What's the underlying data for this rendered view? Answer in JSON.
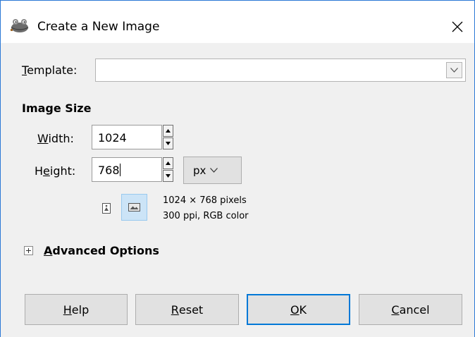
{
  "window": {
    "title": "Create a New Image",
    "icon": "gimp-wilber-icon",
    "close_icon": "close-icon"
  },
  "template": {
    "label_mnemonic": "T",
    "label_rest": "emplate:",
    "value": ""
  },
  "image_size": {
    "section_title": "Image Size",
    "width": {
      "label_mnemonic": "W",
      "label_rest": "idth:",
      "value": "1024"
    },
    "height": {
      "label_before": "H",
      "label_mnemonic": "e",
      "label_after": "ight:",
      "value": "768"
    },
    "unit": "px",
    "info_line1": "1024 × 768 pixels",
    "info_line2": "300 ppi, RGB color",
    "orientation_selected": "landscape"
  },
  "advanced": {
    "expander_symbol": "⊞",
    "label_mnemonic": "A",
    "label_rest": "dvanced Options"
  },
  "buttons": {
    "help": {
      "mnemonic": "H",
      "rest": "elp"
    },
    "reset": {
      "mnemonic": "R",
      "rest": "eset"
    },
    "ok": {
      "mnemonic": "O",
      "rest": "K"
    },
    "cancel": {
      "mnemonic": "C",
      "rest": "ancel"
    }
  },
  "colors": {
    "window_border": "#2b79d6",
    "dialog_bg": "#f0f0f0",
    "default_button_border": "#0078d7",
    "selected_toggle_bg": "#cce4f7"
  }
}
